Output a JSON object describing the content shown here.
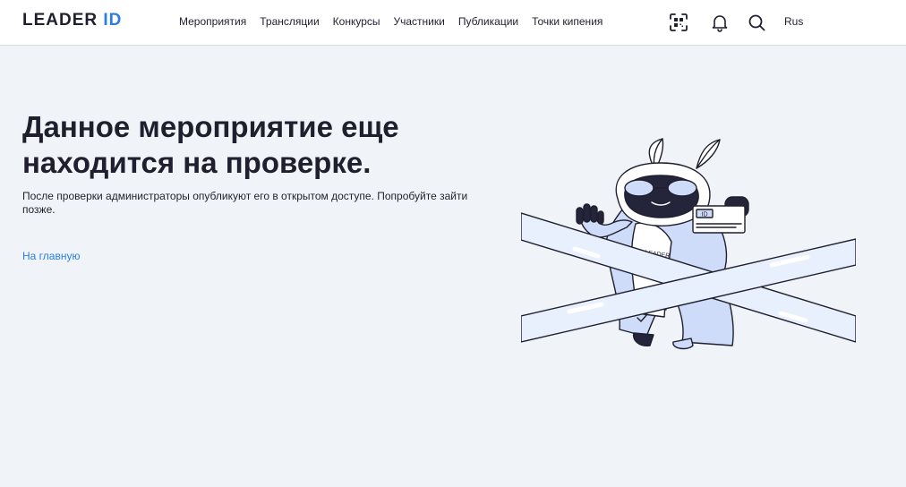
{
  "header": {
    "logo_main": "LEADER",
    "logo_id": "ID",
    "nav": [
      {
        "label": "Мероприятия"
      },
      {
        "label": "Трансляции"
      },
      {
        "label": "Конкурсы"
      },
      {
        "label": "Участники"
      },
      {
        "label": "Публикации"
      },
      {
        "label": "Точки кипения"
      }
    ],
    "icons": [
      "qr-scan-icon",
      "bell-icon",
      "search-icon"
    ],
    "language": "Rus"
  },
  "main": {
    "title": "Данное мероприятие еще находится на проверке.",
    "subtitle": "После проверки администраторы опубликуют его в открытом доступе. Попробуйте зайти позже.",
    "home_link": "На главную"
  },
  "illustration": {
    "badge_text": "ID",
    "chest_text": "LEADER"
  },
  "colors": {
    "accent": "#2a7de1",
    "background": "#f0f4f8",
    "text": "#1f1f2e",
    "illustration_fill": "#cfdcf9",
    "illustration_stroke": "#1f1f2e"
  }
}
